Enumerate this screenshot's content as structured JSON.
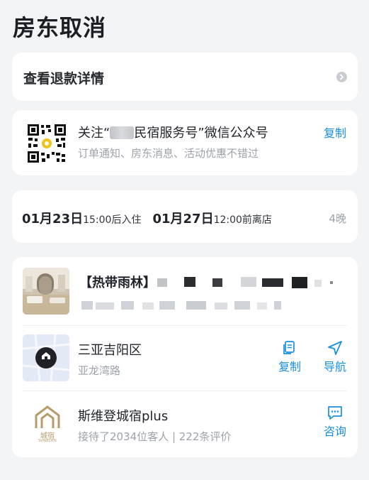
{
  "header": {
    "title": "房东取消"
  },
  "refund": {
    "label": "查看退款详情"
  },
  "wechat": {
    "title_prefix": "关注“",
    "title_suffix": "民宿服务号”微信公众号",
    "subtitle": "订单通知、房东消息、活动优惠不错过",
    "copy_label": "复制",
    "qr_icon": "qr-code-icon"
  },
  "stay": {
    "checkin_date": "01月23日",
    "checkin_time": "15:00后入住",
    "checkout_date": "01月27日",
    "checkout_time": "12:00前离店",
    "nights": "4晚"
  },
  "listing": {
    "name": "【热带雨林】"
  },
  "address": {
    "district": "三亚吉阳区",
    "road": "亚龙湾路",
    "copy_label": "复制",
    "nav_label": "导航"
  },
  "host": {
    "name": "斯维登城宿plus",
    "stats": "接待了2034位客人 | 222条评价",
    "consult_label": "咨询",
    "logo_text": "城宿",
    "logo_sub": "SVWEDEN"
  },
  "colors": {
    "accent": "#1a8fe0",
    "background": "#f3f4f6",
    "card": "#ffffff",
    "muted_text": "#9ea3ab"
  }
}
